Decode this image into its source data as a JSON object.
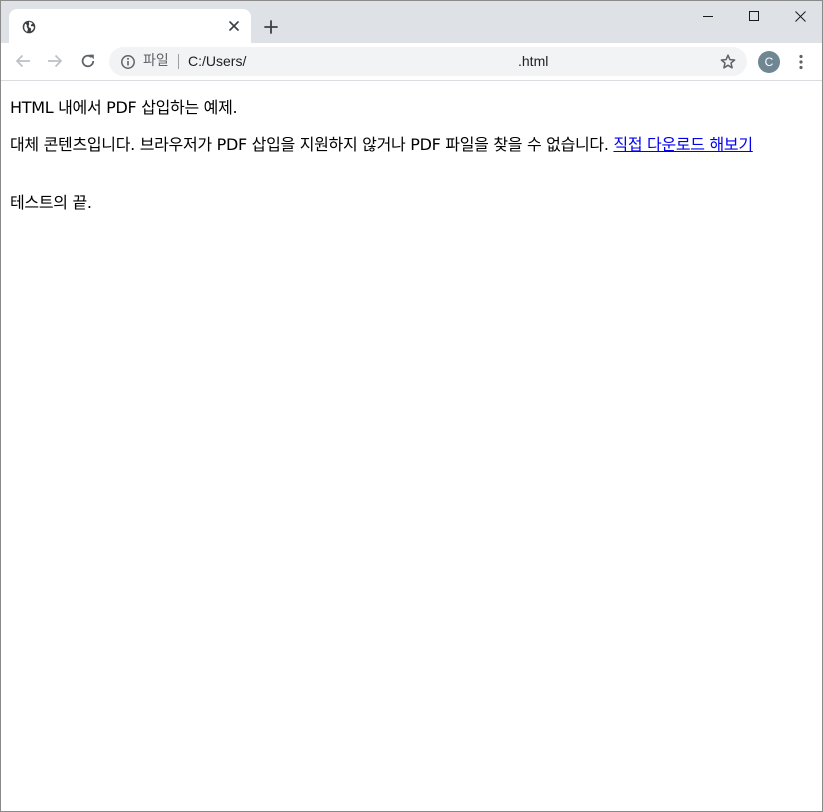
{
  "browser": {
    "tab": {
      "title": "",
      "favicon_icon": "globe-icon",
      "close_icon": "close-icon"
    },
    "newtab_icon": "plus-icon",
    "window_controls": [
      "minimize-icon",
      "maximize-icon",
      "close-icon"
    ],
    "toolbar": {
      "back_icon": "arrow-left-icon",
      "forward_icon": "arrow-right-icon",
      "reload_icon": "reload-icon",
      "address": {
        "info_icon": "info-icon",
        "scheme_chip": "파일",
        "url_prefix": "C:/Users/",
        "url_suffix": ".html",
        "star_icon": "star-icon"
      },
      "profile_initial": "C",
      "profile_color": "#6f8693",
      "menu_icon": "kebab-menu-icon"
    },
    "colors": {
      "tabstrip_bg": "#dee1e6",
      "omnibox_bg": "#f1f3f4",
      "link": "#0000ee"
    }
  },
  "page": {
    "intro": "HTML 내에서 PDF 삽입하는 예제.",
    "fallback_text": "대체 콘텐츠입니다. 브라우저가 PDF 삽입을 지원하지 않거나 PDF 파일을 찾을 수 없습니다. ",
    "download_link": "직접 다운로드 해보기",
    "ending": "테스트의 끝."
  }
}
